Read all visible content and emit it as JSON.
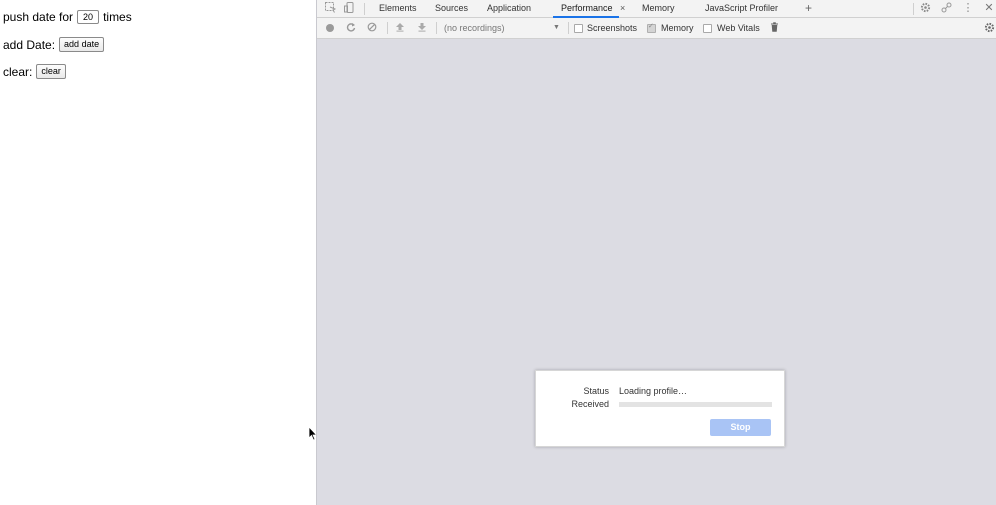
{
  "page": {
    "push_label_before": "push date for",
    "push_count": "20",
    "push_label_after": "times",
    "add_label": "add Date:",
    "add_button": "add date",
    "clear_label": "clear:",
    "clear_button": "clear"
  },
  "devtools": {
    "tabs": [
      {
        "label": "Elements"
      },
      {
        "label": "Sources"
      },
      {
        "label": "Application"
      },
      {
        "label": "Performance",
        "active": true,
        "close": "×"
      },
      {
        "label": "Memory"
      },
      {
        "label": "JavaScript Profiler"
      }
    ],
    "add_tab": "+",
    "toolbar": {
      "recordings_select": "(no recordings)",
      "dropdown_arrow": "▼",
      "checkboxes": [
        {
          "label": "Screenshots",
          "checked": false
        },
        {
          "label": "Memory",
          "checked": true
        },
        {
          "label": "Web Vitals",
          "checked": false
        }
      ]
    },
    "icons": [
      "inspect-icon",
      "device-toggle-icon",
      "settings-icon",
      "customize-icon",
      "more-vert-icon",
      "close-icon",
      "record-icon",
      "reload-icon",
      "clear-icon",
      "upload-icon",
      "download-icon",
      "trash-icon",
      "capture-settings-icon"
    ],
    "accent_color": "#1a73e8",
    "dialog": {
      "status_label": "Status",
      "status_value": "Loading profile…",
      "received_label": "Received",
      "received_progress": 0.0,
      "stop_button": "Stop"
    }
  }
}
